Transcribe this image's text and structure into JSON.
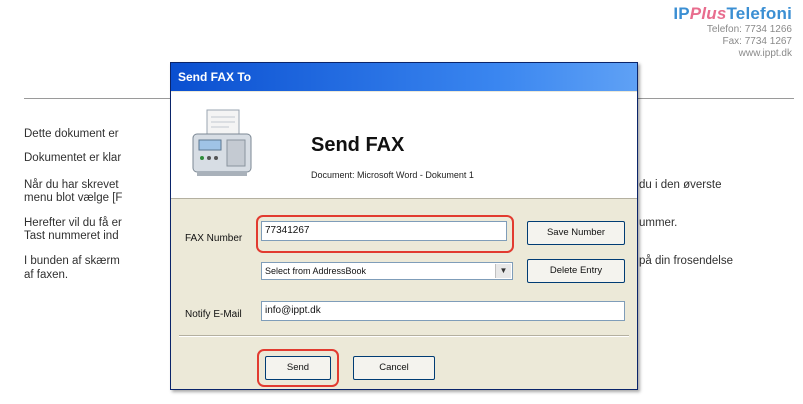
{
  "letterhead": {
    "logo_ip": "IP",
    "logo_plus": "Plus",
    "logo_telefoni": "Telefoni",
    "phone": "Telefon: 7734 1266",
    "fax": "Fax: 7734 1267",
    "web": "www.ippt.dk"
  },
  "document": {
    "line1": "Dette dokument er",
    "line2": "Dokumentet er klar",
    "line3a": "Når du har skrevet",
    "line3a_right": "du i den øverste",
    "line3b": "menu blot vælge [F",
    "line4a": "Herefter vil du få er",
    "line4a_right": "ummer.",
    "line4b": "Tast nummeret ind",
    "line5a": "I bunden af skærm",
    "line5a_right": "på din frosendelse",
    "line5b": "af faxen."
  },
  "dialog": {
    "title": "Send FAX To",
    "header_title": "Send FAX",
    "document_label": "Document: Microsoft Word - Dokument 1",
    "fax_number_label": "FAX Number",
    "fax_number_value": "77341267",
    "save_number_label": "Save Number",
    "addressbook_selected": "Select from AddressBook",
    "delete_entry_label": "Delete Entry",
    "notify_label": "Notify E-Mail",
    "notify_value": "info@ippt.dk",
    "send_label": "Send",
    "cancel_label": "Cancel"
  },
  "colors": {
    "titlebar": "#0a4fd0",
    "highlight": "#e23b30",
    "logo_blue": "#3b8fd3",
    "logo_pink": "#e86d8e"
  }
}
